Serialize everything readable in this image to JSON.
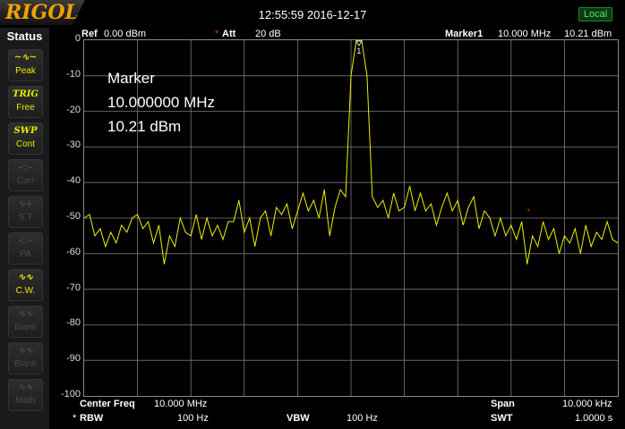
{
  "app": {
    "brand": "RIGOL",
    "datetime": "12:55:59 2016-12-17",
    "remote_state": "Local"
  },
  "status_panel": {
    "title": "Status",
    "buttons": [
      {
        "icon": "peak-icon",
        "glyph": "~∿~",
        "label": "Peak",
        "active": true
      },
      {
        "icon": "trig-icon",
        "glyph": "TRIG",
        "label": "Free",
        "active": true
      },
      {
        "icon": "sweep-icon",
        "glyph": "SWP",
        "label": "Cont",
        "active": true
      },
      {
        "icon": "corr-icon",
        "glyph": "-◇-",
        "label": "Corr",
        "active": false
      },
      {
        "icon": "source-track-icon",
        "glyph": "∿+",
        "label": "S.T",
        "active": false
      },
      {
        "icon": "preamp-icon",
        "glyph": "-▷-",
        "label": "PA",
        "active": false
      },
      {
        "icon": "cw-icon",
        "glyph": "∿∿",
        "label": "C.W.",
        "active": true
      },
      {
        "icon": "blank-icon",
        "glyph": "∿∿",
        "label": "Blank",
        "active": false
      },
      {
        "icon": "blank-icon",
        "glyph": "∿∿",
        "label": "Blank",
        "active": false
      },
      {
        "icon": "math-icon",
        "glyph": "∿∿",
        "label": "Math",
        "active": false
      }
    ]
  },
  "header": {
    "ref_label": "Ref",
    "ref_value": "0.00 dBm",
    "att_label": "Att",
    "att_value": "20 dB",
    "marker_label": "Marker1",
    "marker_freq": "10.000 MHz",
    "marker_amp": "10.21 dBm"
  },
  "marker_readout": {
    "title": "Marker",
    "freq": "10.000000 MHz",
    "amp": "10.21 dBm",
    "marker_number": "1"
  },
  "footer": {
    "center_freq_label": "Center Freq",
    "center_freq_value": "10.000 MHz",
    "span_label": "Span",
    "span_value": "10.000 kHz",
    "rbw_label": "RBW",
    "rbw_value": "100 Hz",
    "vbw_label": "VBW",
    "vbw_value": "100 Hz",
    "swt_label": "SWT",
    "swt_value": "1.0000 s"
  },
  "colors": {
    "trace": "#f0f000",
    "grid": "#7a7a7a",
    "brand": "#f0a000",
    "active_icon": "#e8e800",
    "marker_flag": "#ff2a2a"
  },
  "chart_data": {
    "type": "line",
    "title": "",
    "xlabel": "",
    "ylabel": "",
    "ylim": [
      -100,
      0
    ],
    "xlim": [
      0,
      100
    ],
    "y_ticks": [
      "0",
      "-10",
      "-20",
      "-30",
      "-40",
      "-50",
      "-60",
      "-70",
      "-80",
      "-90",
      "-100"
    ],
    "grid": true,
    "series": [
      {
        "values": [
          [
            0,
            -50
          ],
          [
            1,
            -49
          ],
          [
            2,
            -55
          ],
          [
            3,
            -53
          ],
          [
            4,
            -58
          ],
          [
            5,
            -54
          ],
          [
            6,
            -57
          ],
          [
            7,
            -52
          ],
          [
            8,
            -54
          ],
          [
            9,
            -50
          ],
          [
            10,
            -49
          ],
          [
            11,
            -53
          ],
          [
            12,
            -51
          ],
          [
            13,
            -57
          ],
          [
            14,
            -52
          ],
          [
            15,
            -63
          ],
          [
            16,
            -55
          ],
          [
            17,
            -58
          ],
          [
            18,
            -50
          ],
          [
            19,
            -54
          ],
          [
            20,
            -55
          ],
          [
            21,
            -49
          ],
          [
            22,
            -56
          ],
          [
            23,
            -50
          ],
          [
            24,
            -55
          ],
          [
            25,
            -52
          ],
          [
            26,
            -56
          ],
          [
            27,
            -51
          ],
          [
            28,
            -51
          ],
          [
            29,
            -45
          ],
          [
            30,
            -54
          ],
          [
            31,
            -50
          ],
          [
            32,
            -58
          ],
          [
            33,
            -50
          ],
          [
            34,
            -48
          ],
          [
            35,
            -55
          ],
          [
            36,
            -47
          ],
          [
            37,
            -49
          ],
          [
            38,
            -46
          ],
          [
            39,
            -53
          ],
          [
            40,
            -48
          ],
          [
            41,
            -43
          ],
          [
            42,
            -48
          ],
          [
            43,
            -45
          ],
          [
            44,
            -50
          ],
          [
            45,
            -42
          ],
          [
            46,
            -55
          ],
          [
            47,
            -47
          ],
          [
            48,
            -42
          ],
          [
            49,
            -44
          ],
          [
            50,
            -10
          ],
          [
            51,
            0
          ],
          [
            52,
            0
          ],
          [
            53,
            -10
          ],
          [
            54,
            -44
          ],
          [
            55,
            -47
          ],
          [
            56,
            -45
          ],
          [
            57,
            -50
          ],
          [
            58,
            -43
          ],
          [
            59,
            -48
          ],
          [
            60,
            -47
          ],
          [
            61,
            -41
          ],
          [
            62,
            -48
          ],
          [
            63,
            -43
          ],
          [
            64,
            -48
          ],
          [
            65,
            -46
          ],
          [
            66,
            -52
          ],
          [
            67,
            -47
          ],
          [
            68,
            -43
          ],
          [
            69,
            -48
          ],
          [
            70,
            -45
          ],
          [
            71,
            -52
          ],
          [
            72,
            -47
          ],
          [
            73,
            -44
          ],
          [
            74,
            -53
          ],
          [
            75,
            -48
          ],
          [
            76,
            -50
          ],
          [
            77,
            -55
          ],
          [
            78,
            -50
          ],
          [
            79,
            -55
          ],
          [
            80,
            -52
          ],
          [
            81,
            -56
          ],
          [
            82,
            -51
          ],
          [
            83,
            -63
          ],
          [
            84,
            -55
          ],
          [
            85,
            -58
          ],
          [
            86,
            -51
          ],
          [
            87,
            -56
          ],
          [
            88,
            -53
          ],
          [
            89,
            -60
          ],
          [
            90,
            -55
          ],
          [
            91,
            -57
          ],
          [
            92,
            -53
          ],
          [
            93,
            -60
          ],
          [
            94,
            -52
          ],
          [
            95,
            -58
          ],
          [
            96,
            -54
          ],
          [
            97,
            -56
          ],
          [
            98,
            -51
          ],
          [
            99,
            -56
          ],
          [
            100,
            -57
          ]
        ]
      }
    ],
    "marker": {
      "x": 51.5,
      "y": 0
    }
  }
}
